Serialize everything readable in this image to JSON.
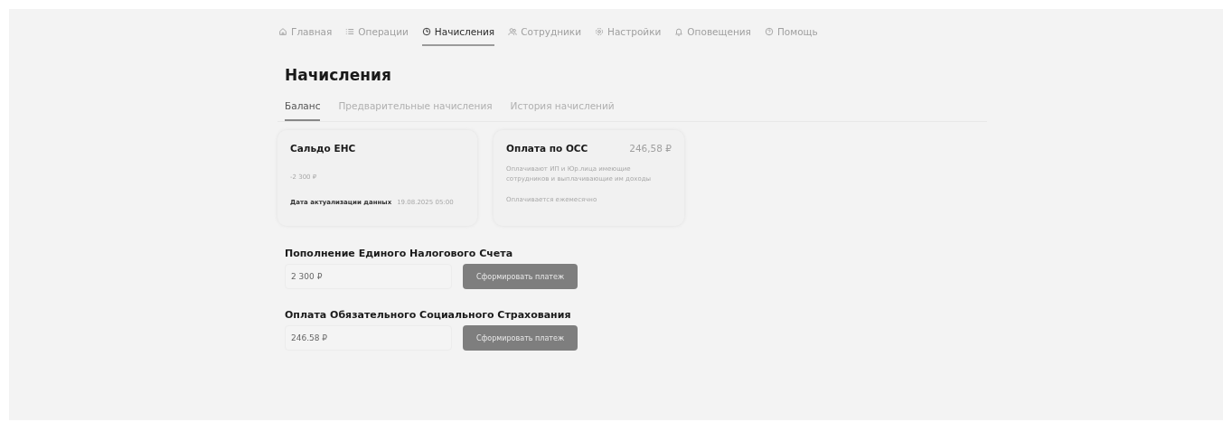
{
  "nav": [
    {
      "label": "Главная",
      "kind": "home",
      "selected": false
    },
    {
      "label": "Операции",
      "kind": "list",
      "selected": false
    },
    {
      "label": "Начисления",
      "kind": "clock",
      "selected": true
    },
    {
      "label": "Сотрудники",
      "kind": "people",
      "selected": false
    },
    {
      "label": "Настройки",
      "kind": "gear",
      "selected": false
    },
    {
      "label": "Оповещения",
      "kind": "bell",
      "selected": false
    },
    {
      "label": "Помощь",
      "kind": "help",
      "selected": false
    }
  ],
  "title": "Начисления",
  "tabs": [
    {
      "label": "Баланс",
      "selected": true
    },
    {
      "label": "Предварительные начисления",
      "selected": false
    },
    {
      "label": "История начислений",
      "selected": false
    }
  ],
  "cards": [
    {
      "kind": "balance",
      "title": "Сальдо ЕНС",
      "amount": "-2 300 ₽",
      "date_label": "Дата актуализации данных",
      "date": "19.08.2025 05:00"
    },
    {
      "kind": "payment",
      "title": "Оплата по ОСС",
      "amount": "246,58 ₽",
      "description": "Оплачивают ИП и Юр.лица имеющие сотрудников и выплачивающие им доходы",
      "note": "Оплачивается ежемесячно"
    }
  ],
  "payments": [
    {
      "heading": "Пополнение Единого Налогового Счета",
      "value": "2 300 ₽",
      "button": "Сформировать платеж"
    },
    {
      "heading": "Оплата Обязательного Социального Страхования",
      "value": "246.58 ₽",
      "button": "Сформировать платеж"
    }
  ]
}
